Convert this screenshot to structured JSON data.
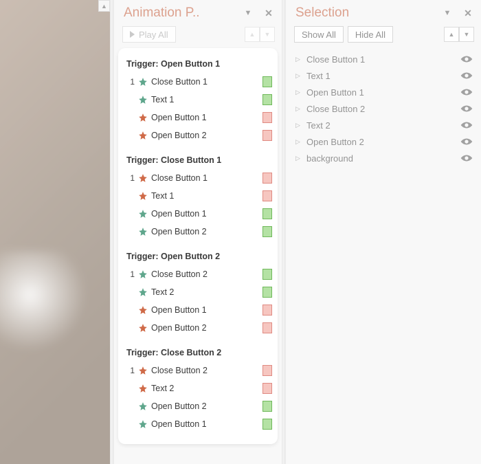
{
  "animation_pane": {
    "title": "Animation P..",
    "play_all_label": "Play All",
    "triggers": [
      {
        "title": "Trigger: Open Button 1",
        "items": [
          {
            "order": "1",
            "icon": "green",
            "label": "Close Button 1",
            "swatch": "green"
          },
          {
            "order": "",
            "icon": "green",
            "label": "Text 1",
            "swatch": "green"
          },
          {
            "order": "",
            "icon": "red",
            "label": "Open Button 1",
            "swatch": "red"
          },
          {
            "order": "",
            "icon": "red",
            "label": "Open Button 2",
            "swatch": "red"
          }
        ]
      },
      {
        "title": "Trigger: Close Button 1",
        "items": [
          {
            "order": "1",
            "icon": "red",
            "label": "Close Button 1",
            "swatch": "red"
          },
          {
            "order": "",
            "icon": "red",
            "label": "Text 1",
            "swatch": "red"
          },
          {
            "order": "",
            "icon": "green",
            "label": "Open Button 1",
            "swatch": "green"
          },
          {
            "order": "",
            "icon": "green",
            "label": "Open Button 2",
            "swatch": "green"
          }
        ]
      },
      {
        "title": "Trigger: Open Button 2",
        "items": [
          {
            "order": "1",
            "icon": "green",
            "label": "Close Button 2",
            "swatch": "green"
          },
          {
            "order": "",
            "icon": "green",
            "label": "Text 2",
            "swatch": "green"
          },
          {
            "order": "",
            "icon": "red",
            "label": "Open Button 1",
            "swatch": "red"
          },
          {
            "order": "",
            "icon": "red",
            "label": "Open Button 2",
            "swatch": "red"
          }
        ]
      },
      {
        "title": "Trigger: Close Button 2",
        "items": [
          {
            "order": "1",
            "icon": "red",
            "label": "Close Button 2",
            "swatch": "red"
          },
          {
            "order": "",
            "icon": "red",
            "label": "Text 2",
            "swatch": "red"
          },
          {
            "order": "",
            "icon": "green",
            "label": "Open Button 2",
            "swatch": "green"
          },
          {
            "order": "",
            "icon": "green",
            "label": "Open Button 1",
            "swatch": "green"
          }
        ]
      }
    ]
  },
  "selection_pane": {
    "title": "Selection",
    "show_all_label": "Show All",
    "hide_all_label": "Hide All",
    "items": [
      {
        "name": "Close Button 1"
      },
      {
        "name": "Text 1"
      },
      {
        "name": "Open Button 1"
      },
      {
        "name": "Close Button 2"
      },
      {
        "name": "Text 2"
      },
      {
        "name": "Open Button 2"
      },
      {
        "name": "background"
      }
    ]
  }
}
